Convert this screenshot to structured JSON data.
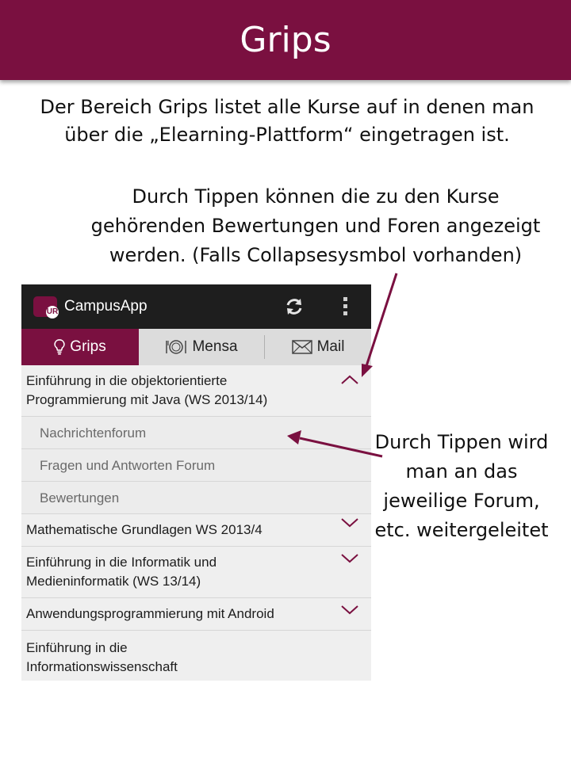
{
  "slide": {
    "title": "Grips",
    "intro_lines": [
      "Der Bereich Grips listet alle Kurse auf in denen man",
      "über die „Elearning-Plattform“ eingetragen ist."
    ],
    "note_top_lines": [
      "Durch Tippen können die zu den Kurse",
      "gehörenden Bewertungen und Foren angezeigt",
      "werden. (Falls Collapsesysmbol vorhanden)"
    ],
    "note_right_lines": [
      "Durch Tippen wird",
      "man an das",
      "jeweilige Forum,",
      "etc. weitergeleitet"
    ],
    "accent_color": "#7a1040"
  },
  "app": {
    "name": "CampusApp",
    "logo_text": "UR",
    "actions": [
      "refresh-icon",
      "overflow-menu-icon"
    ],
    "tabs": [
      {
        "label": "Grips",
        "icon": "lightbulb-icon",
        "active": true
      },
      {
        "label": "Mensa",
        "icon": "plate-cutlery-icon",
        "active": false
      },
      {
        "label": "Mail",
        "icon": "envelope-icon",
        "active": false
      }
    ],
    "courses": [
      {
        "lines": [
          "Einführung in die objektorientierte",
          "Programmierung mit Java (WS 2013/14)"
        ],
        "expanded": true,
        "items": [
          "Nachrichtenforum",
          "Fragen und Antworten Forum",
          "Bewertungen"
        ]
      },
      {
        "lines": [
          "Mathematische Grundlagen WS 2013/4"
        ],
        "expanded": false
      },
      {
        "lines": [
          "Einführung in die Informatik und",
          "Medieninformatik (WS 13/14)"
        ],
        "expanded": false
      },
      {
        "lines": [
          "Anwendungsprogrammierung mit Android"
        ],
        "expanded": false
      },
      {
        "lines": [
          "Einführung in die",
          "Informationswissenschaft"
        ],
        "expanded": null
      }
    ]
  }
}
